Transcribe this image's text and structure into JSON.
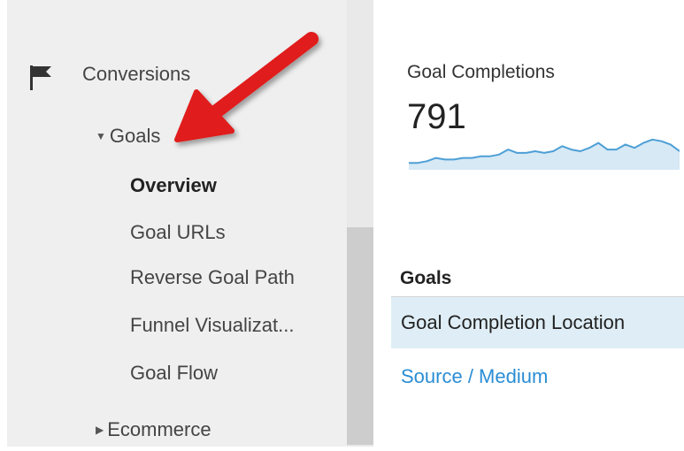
{
  "sidebar": {
    "conversions_label": "Conversions",
    "goals_label": "Goals",
    "goal_items": [
      "Overview",
      "Goal URLs",
      "Reverse Goal Path",
      "Funnel Visualizat...",
      "Goal Flow"
    ],
    "ecommerce_label": "Ecommerce"
  },
  "metric": {
    "label": "Goal Completions",
    "value": "791"
  },
  "chart_data": {
    "type": "area",
    "title": "",
    "xlabel": "",
    "ylabel": "",
    "y": [
      2,
      2,
      3,
      5,
      4,
      4,
      5,
      5,
      6,
      6,
      7,
      10,
      8,
      8,
      9,
      8,
      9,
      12,
      10,
      9,
      11,
      14,
      10,
      10,
      13,
      11,
      14,
      16,
      15,
      13,
      9
    ]
  },
  "dimensions": {
    "header": "Goals",
    "selected": "Goal Completion Location",
    "link": "Source / Medium"
  },
  "colors": {
    "sidebar_bg": "#efefef",
    "selected_row_bg": "#dfeef6",
    "link": "#2a8dd4",
    "sparkline_stroke": "#4d9fd6",
    "arrow": "#e01b1b"
  }
}
